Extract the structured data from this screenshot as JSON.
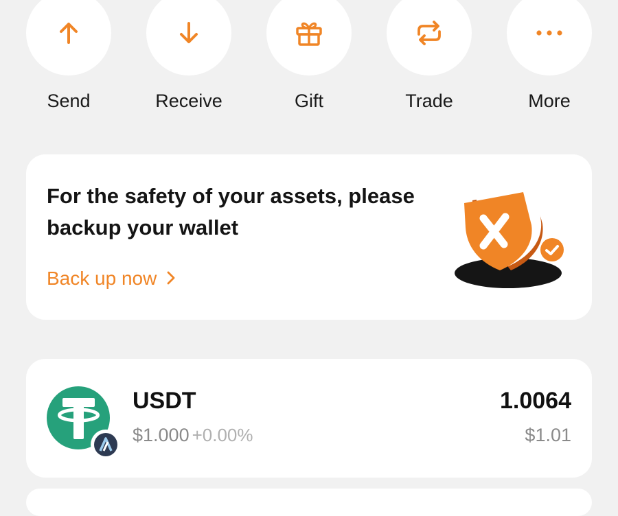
{
  "colors": {
    "accent": "#f08526",
    "background": "#f1f1f1",
    "card": "#ffffff",
    "usdt": "#26a17b"
  },
  "actions": [
    {
      "label": "Send",
      "icon": "arrow-up-icon"
    },
    {
      "label": "Receive",
      "icon": "arrow-down-icon"
    },
    {
      "label": "Gift",
      "icon": "gift-icon"
    },
    {
      "label": "Trade",
      "icon": "swap-icon"
    },
    {
      "label": "More",
      "icon": "more-dots-icon"
    }
  ],
  "backup": {
    "title": "For the safety of your assets, please backup your wallet",
    "link_label": "Back up now",
    "link_icon": "chevron-right-icon",
    "illustration": "shield-illustration"
  },
  "assets": [
    {
      "symbol": "USDT",
      "price": "$1.000",
      "change": "+0.00%",
      "amount": "1.0064",
      "value": "$1.01",
      "icon": "tether-logo",
      "network_icon": "arbitrum-badge-icon"
    }
  ]
}
